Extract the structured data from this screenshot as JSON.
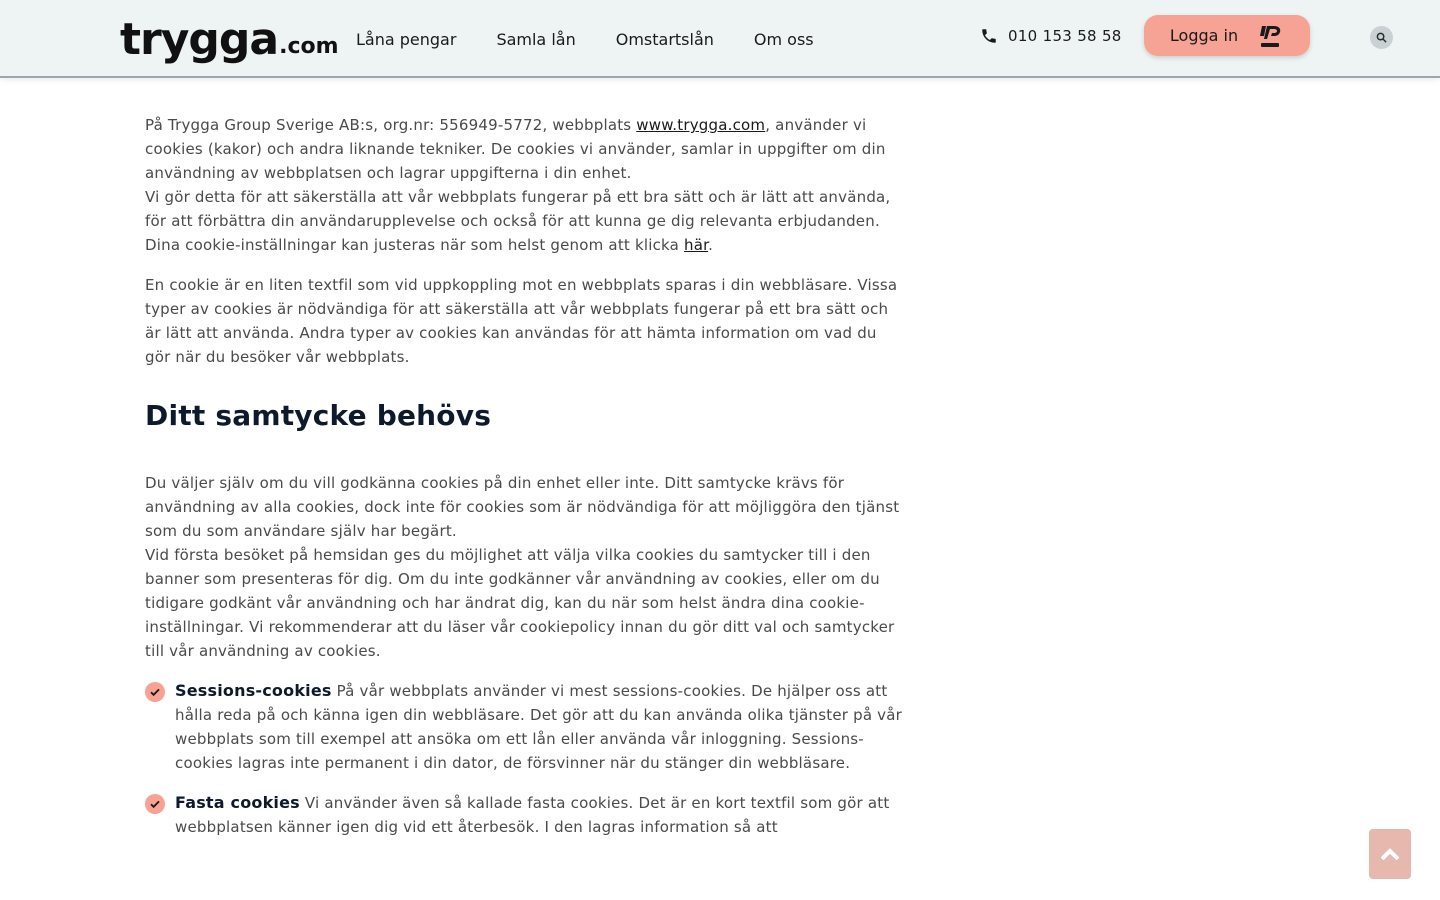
{
  "header": {
    "logo_main": "trygga",
    "logo_suffix": ".com",
    "nav": [
      "Låna pengar",
      "Samla lån",
      "Omstartslån",
      "Om oss"
    ],
    "phone": "010 153 58 58",
    "login_label": "Logga in",
    "icons": {
      "phone": "phone-icon",
      "bankid": "bankid-icon",
      "search": "search-icon"
    }
  },
  "intro": {
    "p1_a": "På Trygga Group Sverige AB:s, org.nr: 556949-5772, webbplats ",
    "p1_link": "www.trygga.com",
    "p1_b": ", använder vi cookies (kakor) och andra liknande tekniker. De cookies vi använder, samlar in uppgifter om din användning av webbplatsen och lagrar uppgifterna i din enhet.",
    "p1_c": "Vi gör detta för att säkerställa att vår webbplats fungerar på ett bra sätt och är lätt att använda, för att förbättra din användarupplevelse och också för att kunna ge dig relevanta erbjudanden.",
    "p1_d": "Dina cookie-inställningar kan justeras när som helst genom att klicka ",
    "p1_link2": "här",
    "p1_end": ".",
    "p2": "En cookie är en liten textfil som vid uppkoppling mot en webbplats sparas i din webbläsare. Vissa typer av cookies är nödvändiga för att säkerställa att vår webbplats fungerar på ett bra sätt och är lätt att använda. Andra typer av cookies kan användas för att hämta information om vad du gör när du besöker vår webbplats."
  },
  "consent": {
    "title": "Ditt samtycke behövs",
    "p1": "Du väljer själv om du vill godkänna cookies på din enhet eller inte. Ditt samtycke krävs för användning av alla cookies, dock inte för cookies som är nödvändiga för att möjliggöra den tjänst som du som användare själv har begärt.",
    "p2": "Vid första besöket på hemsidan ges du möjlighet att välja vilka cookies du samtycker till i den banner som presenteras för dig. Om du inte godkänner vår användning av cookies, eller om du tidigare godkänt vår användning och har ändrat dig, kan du när som helst ändra dina cookie-inställningar. Vi rekommenderar att du läser vår cookiepolicy innan du gör ditt val och samtycker till vår användning av cookies.",
    "items": [
      {
        "title": "Sessions-cookies",
        "text": " På vår webbplats använder vi mest sessions-cookies. De hjälper oss att hålla reda på och känna igen din webbläsare. Det gör att du kan använda olika tjänster på vår webbplats som till exempel att ansöka om ett lån eller använda vår inloggning. Sessions-cookies lagras inte permanent i din dator, de försvinner när du stänger din webbläsare."
      },
      {
        "title": "Fasta cookies",
        "text": " Vi använder även så kallade fasta cookies. Det är en kort textfil som gör att webbplatsen känner igen dig vid ett återbesök. I den lagras information så att"
      }
    ]
  },
  "colors": {
    "accent": "#f6a294",
    "header_bg": "#eef3f4",
    "heading": "#0e1a2b"
  }
}
